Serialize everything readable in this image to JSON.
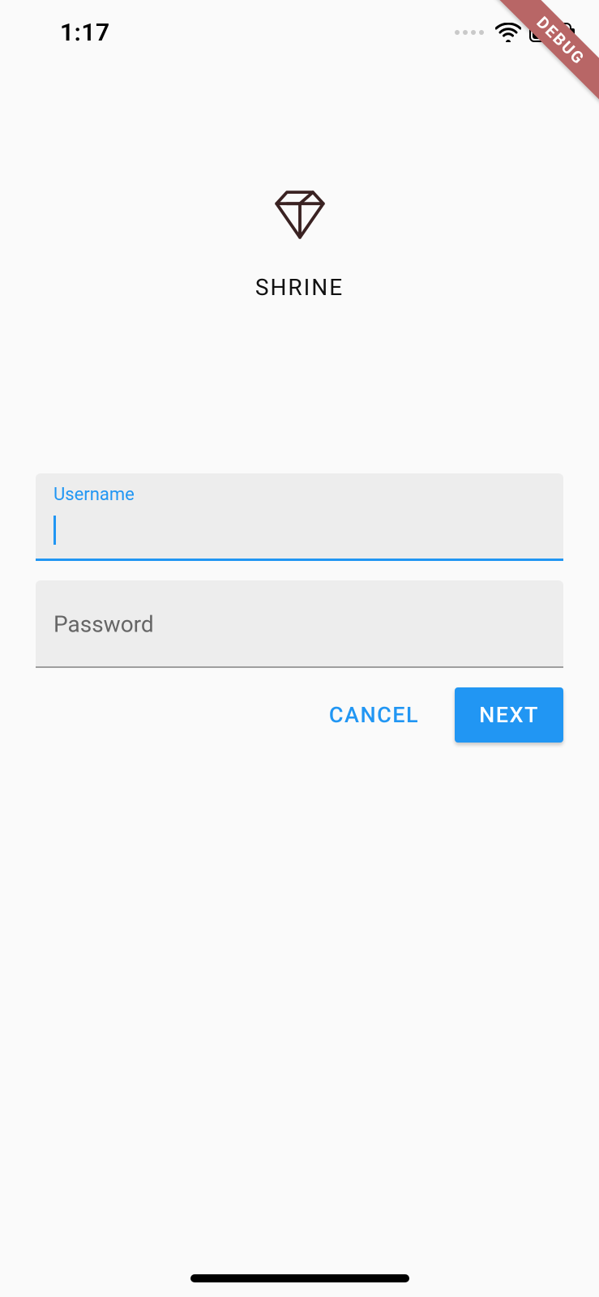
{
  "status_bar": {
    "time": "1:17"
  },
  "debug_banner": "DEBUG",
  "app": {
    "title": "SHRINE",
    "logo_icon": "diamond-icon"
  },
  "form": {
    "username": {
      "label": "Username",
      "value": ""
    },
    "password": {
      "label": "Password",
      "value": ""
    }
  },
  "buttons": {
    "cancel": "CANCEL",
    "next": "NEXT"
  },
  "colors": {
    "primary": "#2196f3",
    "field_bg": "#ededed",
    "debug_banner": "#b86666"
  }
}
